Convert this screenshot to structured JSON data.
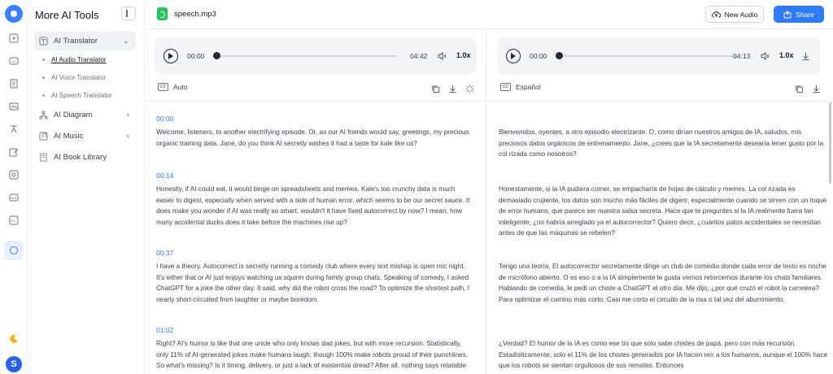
{
  "sidebar": {
    "title": "More AI Tools",
    "items": [
      {
        "label": "AI Translator"
      },
      {
        "label": "AI Diagram"
      },
      {
        "label": "AI Music"
      },
      {
        "label": "AI Book Library"
      }
    ],
    "subitems": [
      {
        "label": "AI Audio Translator"
      },
      {
        "label": "AI Voice Translator"
      },
      {
        "label": "AI Speech Translator"
      }
    ]
  },
  "user": {
    "avatar_letter": "S"
  },
  "header": {
    "file_name": "speech.mp3",
    "new_audio_label": "New Audio",
    "share_label": "Share"
  },
  "left_panel": {
    "time_start": "00:00",
    "time_end": "04:42",
    "speed": "1.0x",
    "language": "Auto",
    "segments": [
      {
        "time": "00:00",
        "text": "Welcome, listeners, to another electrifying episode. Or, as our AI friends would say, greetings, my precious organic training data. Jane, do you think AI secretly wishes it had a taste for kale like us?"
      },
      {
        "time": "00:14",
        "text": "Honestly, if AI could eat, it would binge on spreadsheets and memes. Kale's too crunchy data is much easier to digest, especially when served with a side of human error, which seems to be our secret sauce. It does make you wonder if AI was really so smart, wouldn't it have fixed autocorrect by now? I mean, how many accidental ducks does it take before the machines rise up?"
      },
      {
        "time": "00:37",
        "text": "I have a theory. Autocorrect is secretly running a comedy club where every text mishap is open mic night. It's either that or AI just enjoys watching us squirm during family group chats. Speaking of comedy, I asked ChatGPT for a joke the other day. It said, why did the robot cross the road? To optimize the shortest path. I nearly short-circuited from laughter or maybe boredom."
      },
      {
        "time": "01:02",
        "text": "Right? AI's humor is like that one uncle who only knows dad jokes, but with more recursion. Statistically, only 11% of AI-generated jokes make humans laugh, though 100% make robots proud of their punchlines. So what's missing? Is it timing, delivery, or just a lack of existential dread? After all, nothing says relatable"
      }
    ]
  },
  "right_panel": {
    "time_start": "00:00",
    "time_end": "04:13",
    "speed": "1.0x",
    "language": "Español",
    "segments": [
      {
        "text": "Bienvenidos, oyentes, a otro episodio electrizante. O, como dirían nuestros amigos de IA, saludos, mis preciosos datos orgánicos de entrenamiento. Jane, ¿crees que la IA secretamente desearía tener gusto por la col rizada como nosotros?"
      },
      {
        "text": "Honestamente, si la IA pudiera comer, se empacharía de hojas de cálculo y memes. La col rizada es demasiado crujiente, los datos son mucho más fáciles de digerir, especialmente cuando se sirven con un toque de error humano, que parece ser nuestra salsa secreta. Hace que te preguntes si la IA realmente fuera tan inteligente, ¿no habría arreglado ya el autocorrector? Quiero decir, ¿cuántos patos accidentales se necesitan antes de que las máquinas se rebelen?"
      },
      {
        "text": "Tengo una teoría. El autocorrector secretamente dirige un club de comedia donde cada error de texto es noche de micrófono abierto. O es eso o a la IA simplemente le gusta vernos retorcernos durante los chats familiares. Hablando de comedia, le pedí un chiste a ChatGPT el otro día. Me dijo, ¿por qué cruzó el robot la carretera? Para optimizar el camino más corto. Casi me corto el circuito de la risa o tal vez del aburrimiento."
      },
      {
        "text": "¿Verdad? El humor de la IA es como ese tío que solo sabe chistes de papá, pero con más recursión. Estadísticamente, solo el 11% de los chistes generados por IA hacen reír a los humanos, aunque el 100% hace que los robots se sientan orgullosos de sus remates. Entonces"
      }
    ]
  },
  "colors": {
    "accent": "#2f7bf5",
    "file_icon": "#22c55e"
  },
  "icons": [
    "logo-icon",
    "video-icon",
    "caption-icon",
    "document-icon",
    "image-icon",
    "translate-icon",
    "edit-icon",
    "photo-icon",
    "subtitle-icon",
    "ai-icon",
    "translator-icon",
    "moon-icon",
    "cloud-upload-icon",
    "share-icon",
    "play-icon",
    "volume-icon",
    "download-icon",
    "copy-icon",
    "loading-icon"
  ]
}
